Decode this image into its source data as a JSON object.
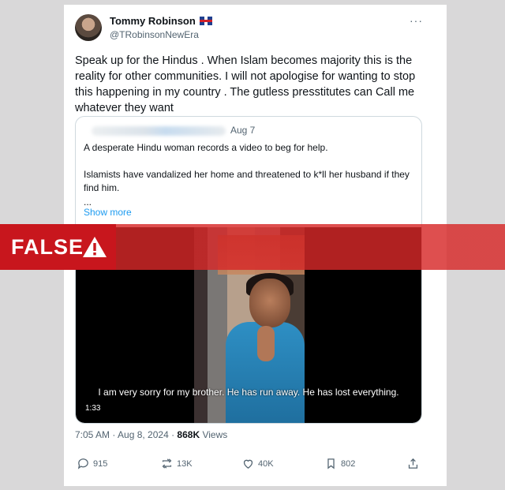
{
  "tweet": {
    "author_name": "Tommy Robinson",
    "author_handle": "@TRobinsonNewEra",
    "more_label": "···",
    "text": "Speak up for the Hindus . When Islam becomes majority this is the reality for other communities. I will not apologise for wanting to stop this happening in my country . The gutless presstitutes can Call me whatever they want",
    "timestamp": "7:05 AM · Aug 8, 2024 · ",
    "views_count": "868K",
    "views_label": " Views"
  },
  "quote": {
    "date": "Aug 7",
    "line1": "A desperate Hindu woman records a video to beg for help.",
    "line2": "Islamists have vandalized her home and threatened to k*ll her husband if they find him.",
    "ellipsis": "...",
    "show_more": "Show more",
    "video_caption": "I am very sorry for my brother. He has run away. He has lost everything.",
    "video_duration": "1:33"
  },
  "actions": {
    "replies": "915",
    "reposts": "13K",
    "likes": "40K",
    "bookmarks": "802"
  },
  "banner": {
    "label": "FALSE",
    "color": "#c8161d"
  },
  "icons": [
    "flag-uk-icon",
    "more-icon",
    "reply-icon",
    "repost-icon",
    "like-icon",
    "bookmark-icon",
    "share-icon",
    "warning-icon"
  ]
}
